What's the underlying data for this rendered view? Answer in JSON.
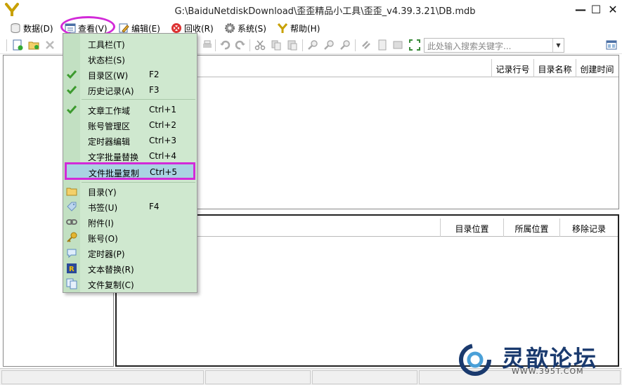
{
  "window": {
    "title": "G:\\BaiduNetdiskDownload\\歪歪精品小工具\\歪歪_v4.39.3.21\\DB.mdb",
    "minimize_glyph": "—",
    "maximize_glyph": "☐",
    "close_glyph": "✕"
  },
  "menubar": {
    "items": [
      {
        "label": "数据(D)",
        "icon": "database-icon"
      },
      {
        "label": "查看(V)",
        "icon": "view-icon"
      },
      {
        "label": "编辑(E)",
        "icon": "edit-icon"
      },
      {
        "label": "回收(R)",
        "icon": "recycle-icon"
      },
      {
        "label": "系统(S)",
        "icon": "gear-icon"
      },
      {
        "label": "帮助(H)",
        "icon": "help-icon"
      }
    ]
  },
  "toolbar": {
    "search_placeholder": "此处输入搜索关键字..."
  },
  "top_panel": {
    "columns": [
      "记录行号",
      "目录名称",
      "创建时间"
    ]
  },
  "bottom_panel": {
    "columns": [
      "目录位置",
      "所属位置",
      "移除记录"
    ]
  },
  "dropdown": {
    "items": [
      {
        "label": "工具栏(T)",
        "key": "",
        "checked": false,
        "icon": ""
      },
      {
        "label": "状态栏(S)",
        "key": "",
        "checked": false,
        "icon": ""
      },
      {
        "label": "目录区(W)",
        "key": "F2",
        "checked": true,
        "icon": "check-icon"
      },
      {
        "label": "历史记录(A)",
        "key": "F3",
        "checked": true,
        "icon": "check-icon"
      },
      {
        "label": "文章工作域",
        "key": "Ctrl+1",
        "checked": true,
        "icon": "check-icon"
      },
      {
        "label": "账号管理区",
        "key": "Ctrl+2",
        "checked": false,
        "icon": ""
      },
      {
        "label": "定时器编辑",
        "key": "Ctrl+3",
        "checked": false,
        "icon": ""
      },
      {
        "label": "文字批量替换",
        "key": "Ctrl+4",
        "checked": false,
        "icon": ""
      },
      {
        "label": "文件批量复制",
        "key": "Ctrl+5",
        "checked": false,
        "icon": ""
      },
      {
        "label": "目录(Y)",
        "key": "",
        "checked": false,
        "icon": "folder-icon"
      },
      {
        "label": "书签(U)",
        "key": "F4",
        "checked": false,
        "icon": "bookmark-icon"
      },
      {
        "label": "附件(I)",
        "key": "",
        "checked": false,
        "icon": "attachment-icon"
      },
      {
        "label": "账号(O)",
        "key": "",
        "checked": false,
        "icon": "key-icon"
      },
      {
        "label": "定时器(P)",
        "key": "",
        "checked": false,
        "icon": "timer-icon"
      },
      {
        "label": "文本替换(R)",
        "key": "",
        "checked": false,
        "icon": "text-replace-icon"
      },
      {
        "label": "文件复制(C)",
        "key": "",
        "checked": false,
        "icon": "file-copy-icon"
      }
    ],
    "selected_index": 8
  },
  "watermark": {
    "text": "灵歆论坛",
    "url": "WWW.395T.COM"
  },
  "colors": {
    "menu_bg": "#cfe8cf",
    "selected_bg": "#a9d3e2",
    "highlight_annotation": "#d22ad8",
    "watermark_blue": "#1a3a6e"
  }
}
